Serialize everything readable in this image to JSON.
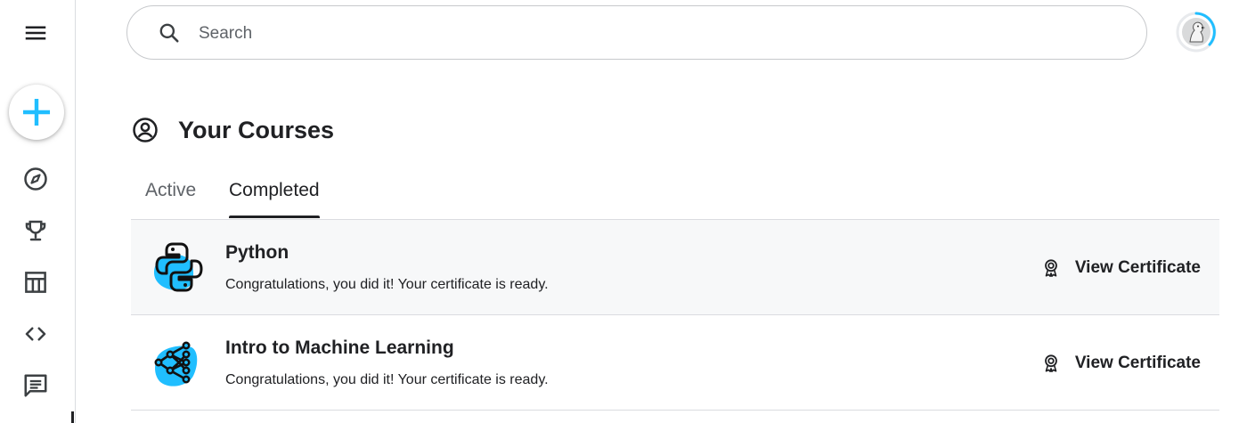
{
  "sidebar": {
    "menu_icon": "hamburger-menu-icon",
    "create_icon": "plus-icon",
    "accent_color": "#20beff",
    "items": [
      {
        "icon": "compass-icon",
        "name": "explore"
      },
      {
        "icon": "trophy-icon",
        "name": "competitions"
      },
      {
        "icon": "table-icon",
        "name": "datasets"
      },
      {
        "icon": "code-icon",
        "name": "code"
      },
      {
        "icon": "comment-icon",
        "name": "discussions"
      }
    ]
  },
  "search": {
    "placeholder": "Search",
    "value": ""
  },
  "page": {
    "title": "Your Courses"
  },
  "tabs": [
    {
      "label": "Active",
      "selected": false
    },
    {
      "label": "Completed",
      "selected": true
    }
  ],
  "courses": [
    {
      "name": "Python",
      "status": "Congratulations, you did it! Your certificate is ready.",
      "action": "View Certificate",
      "icon": "python-logo-icon"
    },
    {
      "name": "Intro to Machine Learning",
      "status": "Congratulations, you did it! Your certificate is ready.",
      "action": "View Certificate",
      "icon": "machine-learning-icon"
    }
  ]
}
